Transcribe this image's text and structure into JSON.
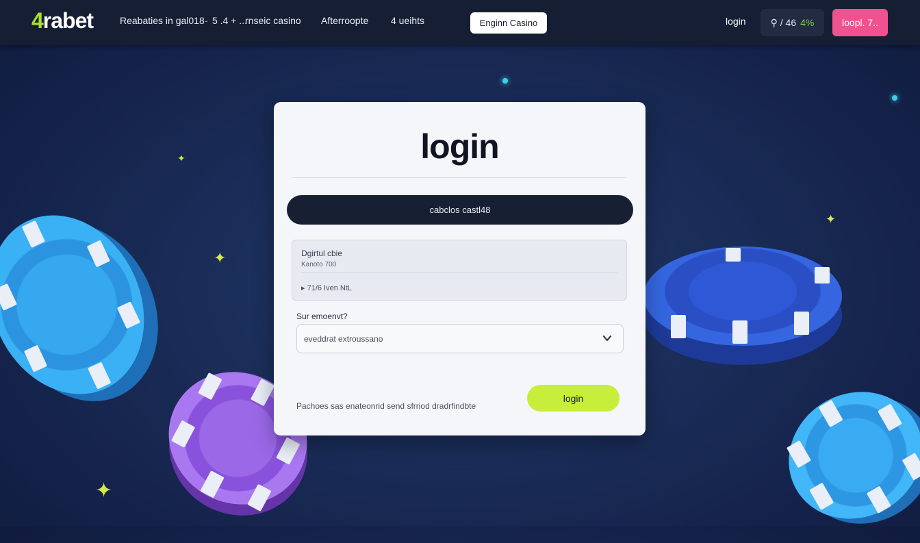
{
  "header": {
    "logo_prefix": "4",
    "logo_suffix": "rabet",
    "nav": [
      {
        "label": "Reabaties in gal018"
      },
      {
        "label": "5 .4 + ..."
      },
      {
        "label": "rnseic casino"
      },
      {
        "label": "Afterroopte"
      },
      {
        "label": "4 ueihts"
      }
    ],
    "nav_separator": "-",
    "casino_button": "Enginn Casino",
    "login_link": "login",
    "balance_prefix": "⚲ / 46",
    "balance_value": "4%",
    "register_button": "loopl. 7.."
  },
  "login_card": {
    "title": "login",
    "dark_button": "cabclos castl48",
    "info": {
      "title": "Dgirtul cbie",
      "subtitle": "Kanoto 700",
      "footer": "▸ 71/6 Iven NtL"
    },
    "select": {
      "label": "Sur emoenvt?",
      "value": "eveddrat extroussano"
    },
    "footer_text": "Pachoes sas enateonrid send sfrriod dradrfindbte",
    "login_button": "login"
  },
  "colors": {
    "accent_green": "#c6ee3a",
    "accent_pink": "#f0528f",
    "background": "#1a2d58"
  }
}
